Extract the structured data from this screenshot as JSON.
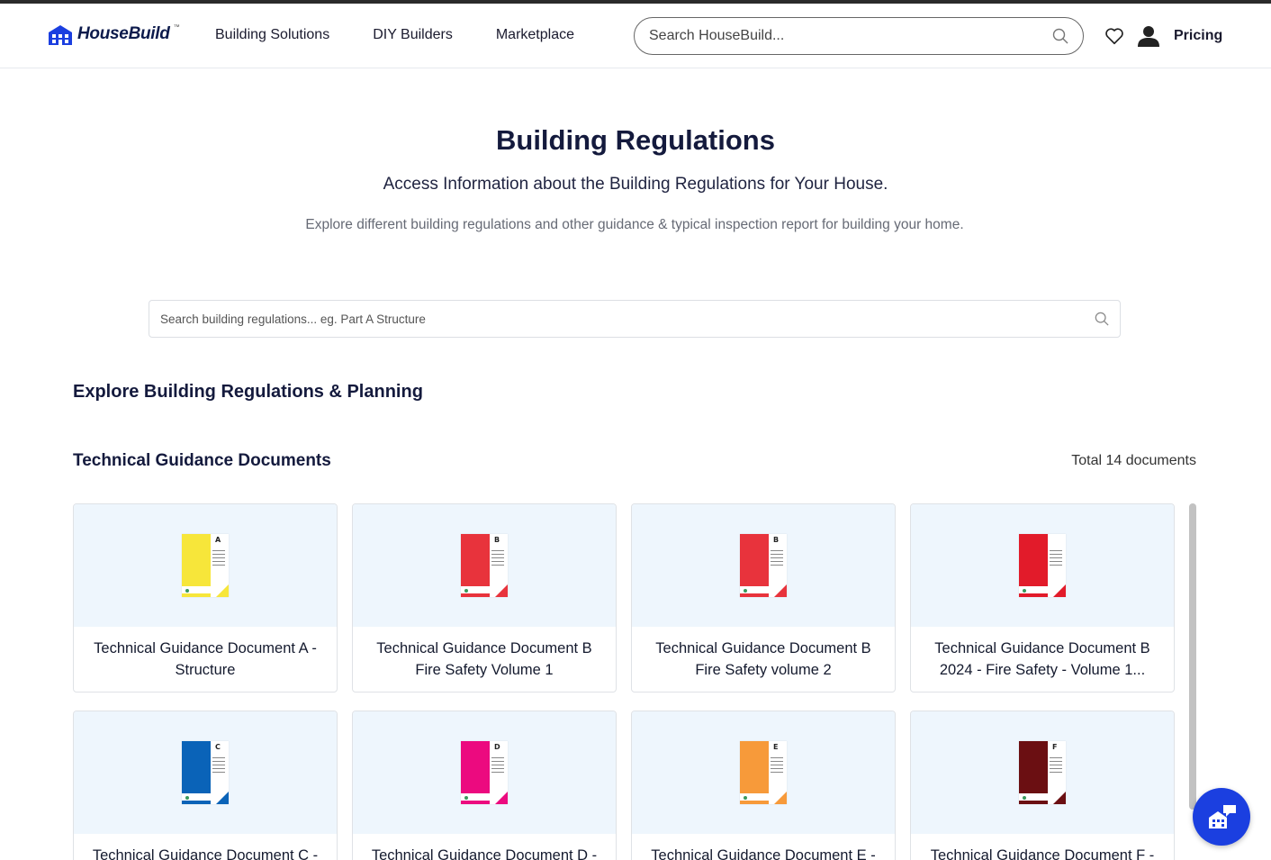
{
  "header": {
    "logo_text": "HouseBuild",
    "logo_tm": "™",
    "nav": [
      "Building Solutions",
      "DIY Builders",
      "Marketplace"
    ],
    "search_placeholder": "Search HouseBuild...",
    "pricing_label": "Pricing"
  },
  "hero": {
    "title": "Building Regulations",
    "subtitle": "Access Information about the Building Regulations for Your House.",
    "description": "Explore different building regulations and other guidance & typical inspection report for building your home."
  },
  "regulations_search": {
    "placeholder": "Search building regulations... eg. Part A Structure"
  },
  "explore_heading": "Explore Building Regulations & Planning",
  "tgd_section": {
    "heading": "Technical Guidance Documents",
    "total": "Total 14 documents",
    "documents": [
      {
        "title": "Technical Guidance Document A - Structure",
        "letter": "A",
        "color": "#f7e63a",
        "accent": "#f7e63a"
      },
      {
        "title": "Technical Guidance Document B Fire Safety Volume 1",
        "letter": "B",
        "color": "#e8333c",
        "accent": "#e8333c"
      },
      {
        "title": "Technical Guidance Document B Fire Safety volume 2",
        "letter": "B",
        "color": "#e8333c",
        "accent": "#e8333c"
      },
      {
        "title": "Technical Guidance Document B 2024 - Fire Safety - Volume 1...",
        "letter": "",
        "color": "#e21b2a",
        "accent": "#e21b2a"
      },
      {
        "title": "Technical Guidance Document C - ",
        "letter": "C",
        "color": "#0a63b8",
        "accent": "#0a63b8"
      },
      {
        "title": "Technical Guidance Document D - ",
        "letter": "D",
        "color": "#ec0a7f",
        "accent": "#ec0a7f"
      },
      {
        "title": "Technical Guidance Document E - ",
        "letter": "E",
        "color": "#f79a3a",
        "accent": "#f79a3a"
      },
      {
        "title": "Technical Guidance Document F - ",
        "letter": "F",
        "color": "#6b0f12",
        "accent": "#6b0f12"
      }
    ]
  },
  "colors": {
    "brand": "#0d1b4c",
    "fab": "#1b3fe0",
    "card_bg": "#eef6fd"
  }
}
